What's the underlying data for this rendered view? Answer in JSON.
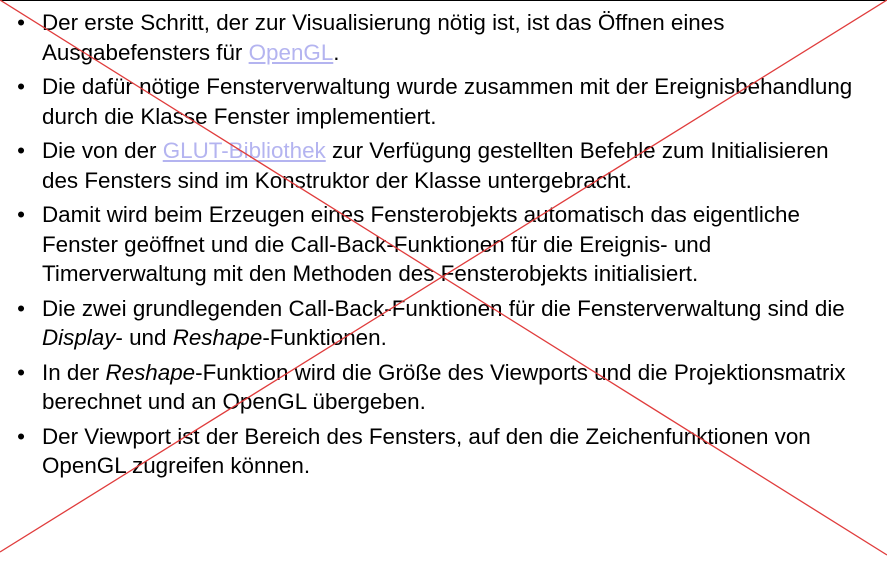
{
  "slide": {
    "bullet_symbol": "•",
    "cross_color": "#e03c3c",
    "link_color": "#b4b4f0",
    "items": [
      {
        "segments": [
          {
            "text": "Der erste Schritt, der zur Visualisierung nötig ist, ist das Öffnen eines Ausgabefensters für ",
            "style": "plain"
          },
          {
            "text": "OpenGL",
            "style": "link"
          },
          {
            "text": ".",
            "style": "plain"
          }
        ]
      },
      {
        "segments": [
          {
            "text": "Die dafür nötige Fensterverwaltung wurde zusammen mit der Ereignisbehandlung durch die Klasse Fenster implementiert.",
            "style": "plain"
          }
        ]
      },
      {
        "segments": [
          {
            "text": "Die von der ",
            "style": "plain"
          },
          {
            "text": "GLUT-Bibliothek",
            "style": "link"
          },
          {
            "text": " zur Verfügung gestellten Befehle zum Initialisieren des Fensters sind im Konstruktor der Klasse untergebracht.",
            "style": "plain"
          }
        ]
      },
      {
        "segments": [
          {
            "text": "Damit wird beim Erzeugen eines Fensterobjekts automatisch das eigentliche Fenster geöffnet und die Call-Back-Funktionen für die Ereignis- und Timerverwaltung mit den Methoden des Fensterobjekts initialisiert.",
            "style": "plain"
          }
        ]
      },
      {
        "segments": [
          {
            "text": "Die zwei grundlegenden Call-Back-Funktionen für die Fensterverwaltung sind die ",
            "style": "plain"
          },
          {
            "text": "Display",
            "style": "italic"
          },
          {
            "text": "- und ",
            "style": "plain"
          },
          {
            "text": "Reshape",
            "style": "italic"
          },
          {
            "text": "-Funktionen.",
            "style": "plain"
          }
        ]
      },
      {
        "segments": [
          {
            "text": "In der ",
            "style": "plain"
          },
          {
            "text": "Reshape",
            "style": "italic"
          },
          {
            "text": "-Funktion wird die Größe des Viewports und die Projektionsmatrix berechnet und an OpenGL übergeben.",
            "style": "plain"
          }
        ]
      },
      {
        "segments": [
          {
            "text": "Der Viewport ist der Bereich des Fensters, auf den die Zeichenfunktionen von OpenGL zugreifen können.",
            "style": "plain"
          }
        ]
      }
    ]
  }
}
